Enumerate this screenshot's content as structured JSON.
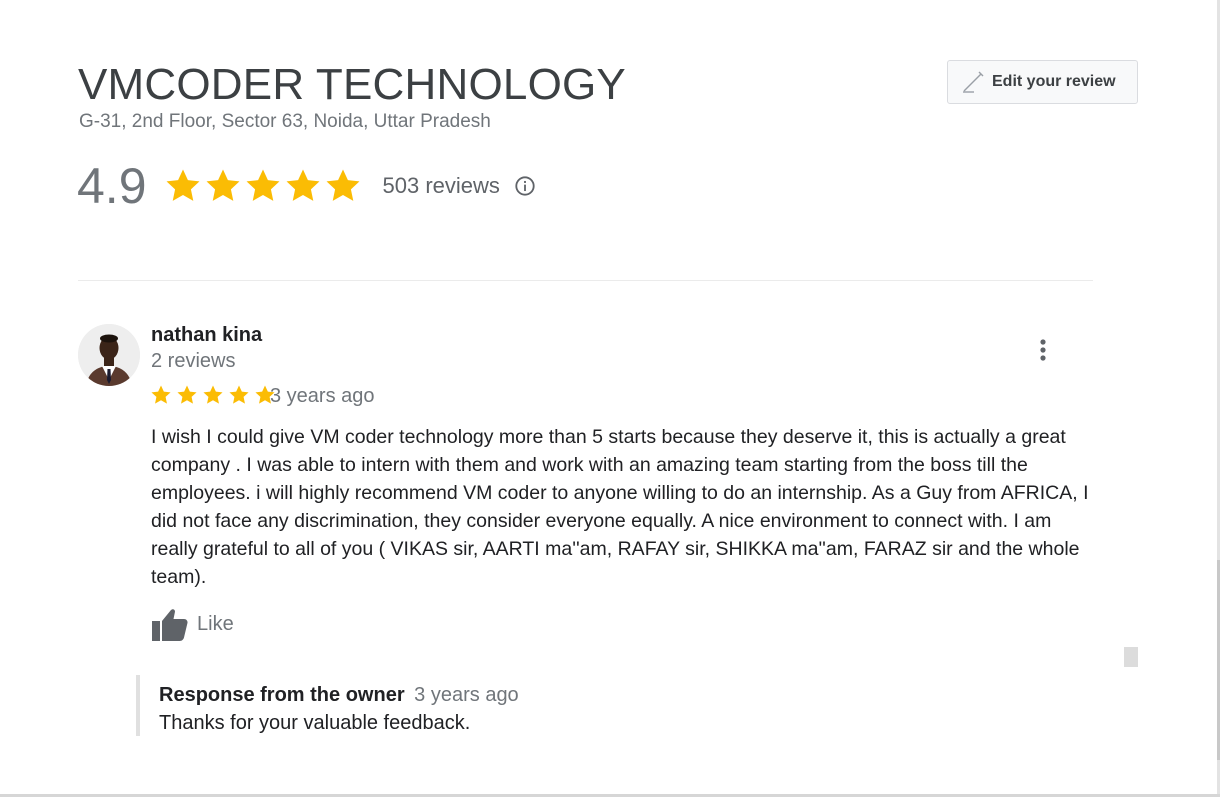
{
  "business": {
    "name": "VMCODER TECHNOLOGY",
    "address": "G-31, 2nd Floor, Sector 63, Noida, Uttar Pradesh",
    "rating": "4.9",
    "rating_stars": 5,
    "review_count": "503 reviews",
    "edit_review_label": "Edit your review"
  },
  "review": {
    "reviewer_name": "nathan kina",
    "reviewer_meta": "2 reviews",
    "stars": 5,
    "date": "3 years ago",
    "text": "I wish I could give VM coder technology  more than 5 starts because they deserve it, this is actually a great company . I was able to intern with them and work with an amazing team starting from the boss till the employees. i will highly recommend VM coder to anyone willing to do an internship. As a Guy from AFRICA, I did not face any discrimination, they consider everyone equally. A nice environment to connect with. I am really grateful to all of you ( VIKAS sir, AARTI ma''am, RAFAY sir, SHIKKA ma''am, FARAZ sir and the whole team).",
    "like_label": "Like"
  },
  "owner_response": {
    "label": "Response from the owner",
    "date": "3 years ago",
    "text": "Thanks for your valuable feedback."
  },
  "icons": {
    "star": "star-icon",
    "info": "info-icon",
    "edit": "edit-pencil-icon",
    "more": "more-vert-icon",
    "like": "thumb-up-icon"
  },
  "colors": {
    "star": "#fbbc04",
    "title": "#3c4043",
    "muted": "#70757a",
    "icon": "#5f6368"
  }
}
